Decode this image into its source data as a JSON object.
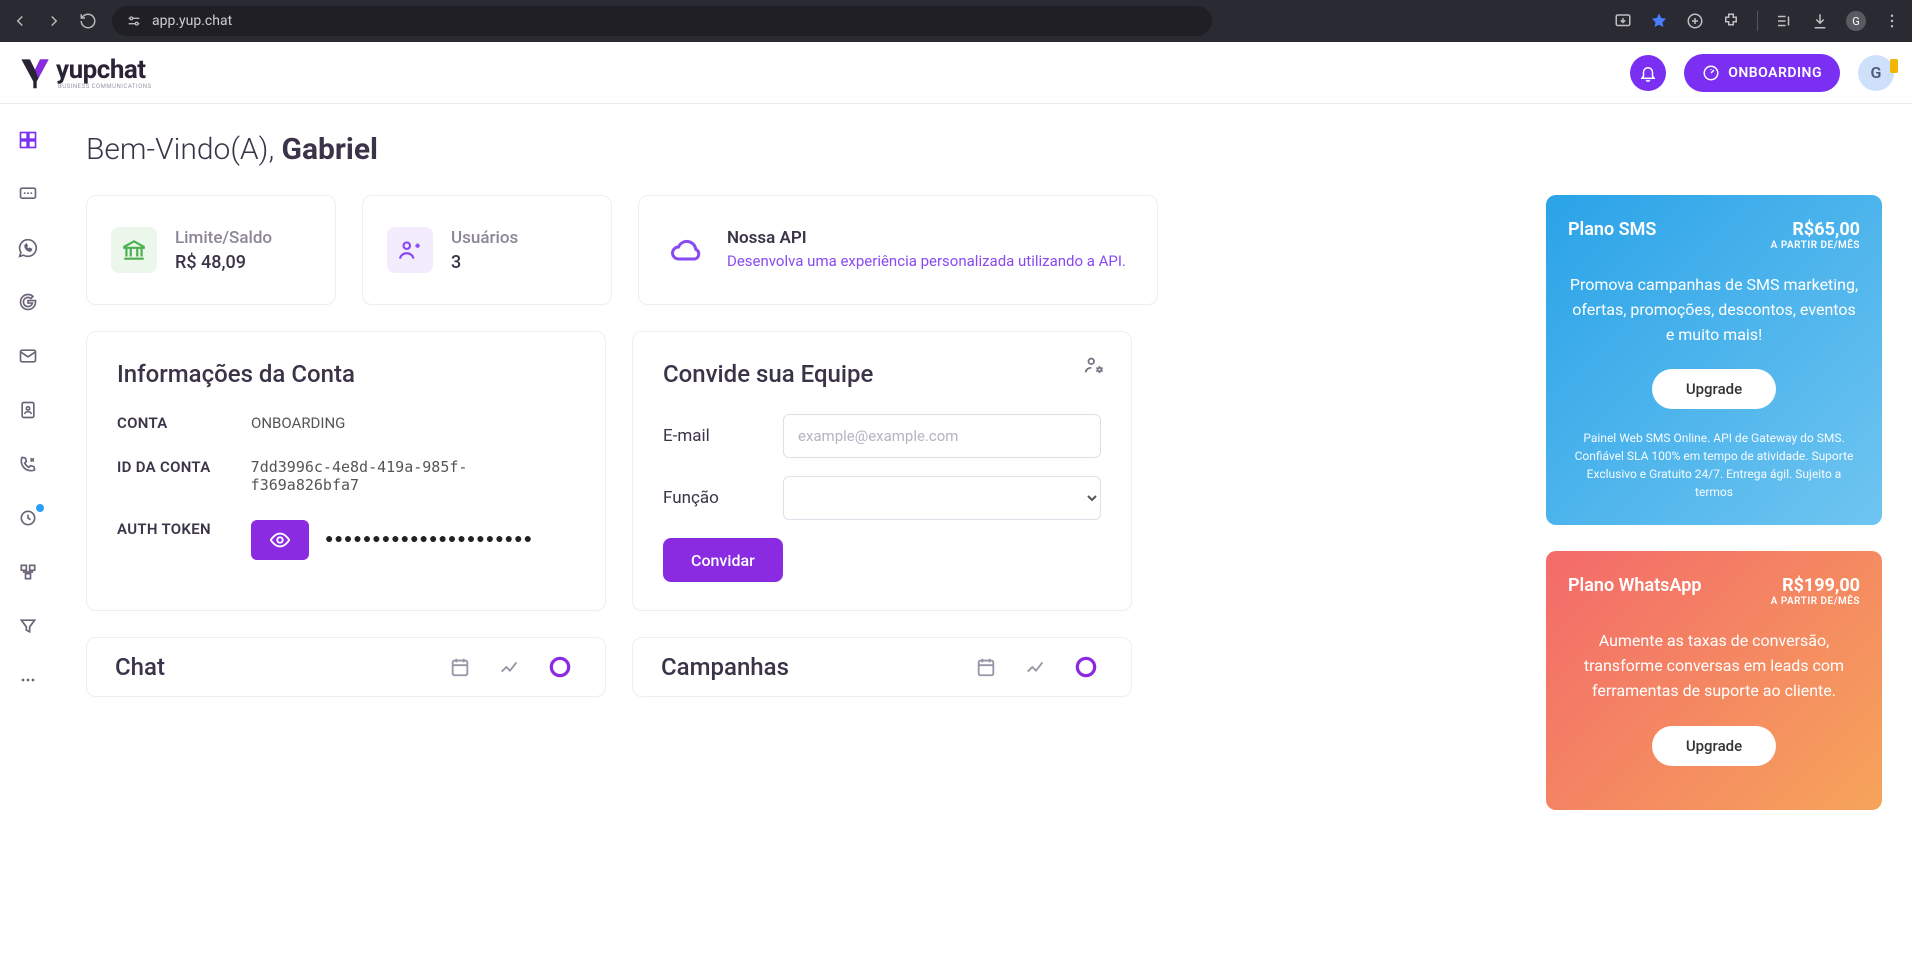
{
  "browser": {
    "url": "app.yup.chat",
    "profile_initial": "G"
  },
  "header": {
    "brand": "yupchat",
    "brand_sub": "BUSINESS COMMUNICATIONS",
    "onboarding_label": "ONBOARDING",
    "avatar_initial": "G"
  },
  "welcome": {
    "greeting": "Bem-Vindo(A), ",
    "name": "Gabriel"
  },
  "stats": {
    "balance_label": "Limite/Saldo",
    "balance_value": "R$ 48,09",
    "users_label": "Usuários",
    "users_value": "3",
    "api_title": "Nossa API",
    "api_desc": "Desenvolva uma experiência personalizada utilizando a API."
  },
  "account": {
    "title": "Informações da Conta",
    "k_account": "CONTA",
    "v_account": "ONBOARDING",
    "k_id": "ID DA CONTA",
    "v_id": "7dd3996c-4e8d-419a-985f-f369a826bfa7",
    "k_token": "AUTH TOKEN",
    "v_token_masked": "●●●●●●●●●●●●●●●●●●●●●●"
  },
  "invite": {
    "title": "Convide sua Equipe",
    "email_label": "E-mail",
    "email_placeholder": "example@example.com",
    "role_label": "Função",
    "submit_label": "Convidar"
  },
  "plans": {
    "sms": {
      "name": "Plano SMS",
      "price": "R$65,00",
      "per": "A PARTIR DE/MÊS",
      "desc": "Promova campanhas de SMS marketing, ofertas, promoções, descontos, eventos e muito mais!",
      "cta": "Upgrade",
      "foot": "Painel Web SMS Online. API de Gateway do SMS. Confiável SLA 100% em tempo de atividade. Suporte Exclusivo e Gratuito 24/7. Entrega ágil. Sujeito a termos"
    },
    "wa": {
      "name": "Plano WhatsApp",
      "price": "R$199,00",
      "per": "A PARTIR DE/MÊS",
      "desc": "Aumente as taxas de conversão, transforme conversas em leads com ferramentas de suporte ao cliente.",
      "cta": "Upgrade"
    }
  },
  "bottom": {
    "chat_title": "Chat",
    "campaigns_title": "Campanhas"
  }
}
